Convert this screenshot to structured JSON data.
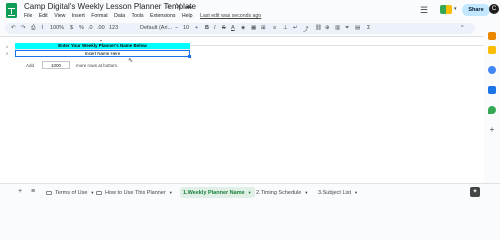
{
  "app": {
    "title": "Camp Digital's Weekly Lesson Planner Template",
    "menu": [
      "File",
      "Edit",
      "View",
      "Insert",
      "Format",
      "Data",
      "Tools",
      "Extensions",
      "Help"
    ],
    "last_edit": "Last edit was seconds ago",
    "share_label": "Share",
    "avatar_initial": "C"
  },
  "toolbar": {
    "zoom": "100%",
    "currency": "$",
    "percent": "%",
    "decimals_dec": ".0",
    "decimals_inc": ".00",
    "number_format": "123",
    "font": "Default (Ari...",
    "font_size": "10",
    "bold": "B",
    "italic": "I",
    "strike": "S",
    "text_color": "A",
    "collapse": "^"
  },
  "sheet": {
    "col_marker": "▾",
    "rows": [
      "1",
      "2"
    ],
    "banner_text": "Enter Your Weekly Planner's Name Below",
    "input_text": "Insert Name Here",
    "add_label": "Add",
    "add_rows_value": "1000",
    "add_rows_suffix": "more rows at bottom."
  },
  "tabs": [
    {
      "label": "Terms of Use",
      "active": false
    },
    {
      "label": "How to Use This Planner",
      "active": false
    },
    {
      "label": "1.Weekly Planner Name",
      "active": true
    },
    {
      "label": "2.Timing Schedule",
      "active": false
    },
    {
      "label": "3.Subject List",
      "active": false
    }
  ],
  "colors": {
    "banner": "#00ffff",
    "active_tab": "#188038",
    "selection": "#1a73e8",
    "share": "#c2e7ff"
  }
}
